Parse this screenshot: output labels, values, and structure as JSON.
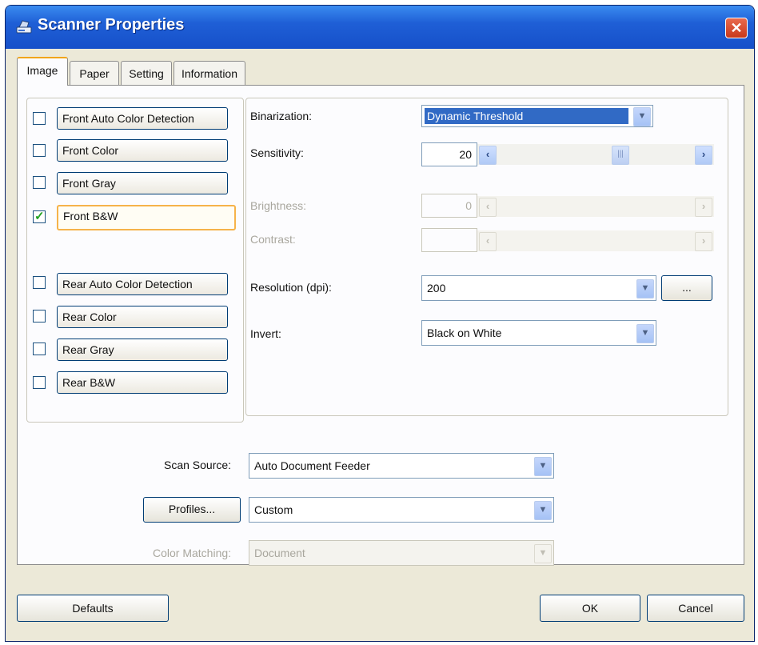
{
  "window": {
    "title": "Scanner Properties"
  },
  "tabs": [
    {
      "label": "Image",
      "active": true
    },
    {
      "label": "Paper",
      "active": false
    },
    {
      "label": "Setting",
      "active": false
    },
    {
      "label": "Information",
      "active": false
    }
  ],
  "image_types": {
    "front": [
      {
        "label": "Front Auto Color Detection",
        "checked": false
      },
      {
        "label": "Front Color",
        "checked": false
      },
      {
        "label": "Front Gray",
        "checked": false
      },
      {
        "label": "Front B&W",
        "checked": true
      }
    ],
    "rear": [
      {
        "label": "Rear Auto Color Detection",
        "checked": false
      },
      {
        "label": "Rear Color",
        "checked": false
      },
      {
        "label": "Rear Gray",
        "checked": false
      },
      {
        "label": "Rear B&W",
        "checked": false
      }
    ]
  },
  "settings": {
    "binarization": {
      "label": "Binarization:",
      "value": "Dynamic Threshold"
    },
    "sensitivity": {
      "label": "Sensitivity:",
      "value": "20"
    },
    "brightness": {
      "label": "Brightness:",
      "value": "0"
    },
    "contrast": {
      "label": "Contrast:",
      "value": ""
    },
    "resolution": {
      "label": "Resolution (dpi):",
      "value": "200",
      "more_button": "..."
    },
    "invert": {
      "label": "Invert:",
      "value": "Black on White"
    }
  },
  "bottom": {
    "scan_source": {
      "label": "Scan Source:",
      "value": "Auto Document Feeder"
    },
    "profiles": {
      "button": "Profiles...",
      "value": "Custom"
    },
    "color_matching": {
      "label": "Color Matching:",
      "value": "Document"
    }
  },
  "footer": {
    "defaults": "Defaults",
    "ok": "OK",
    "cancel": "Cancel"
  },
  "icons": {
    "combo_arrow": "chevron-down-icon",
    "scroll_left": "chevron-left-icon",
    "scroll_right": "chevron-right-icon"
  },
  "colors": {
    "titlebar": "#1f5fd6",
    "selection": "#316ac5",
    "focus": "#f1a51b",
    "face": "#ece9d8"
  }
}
